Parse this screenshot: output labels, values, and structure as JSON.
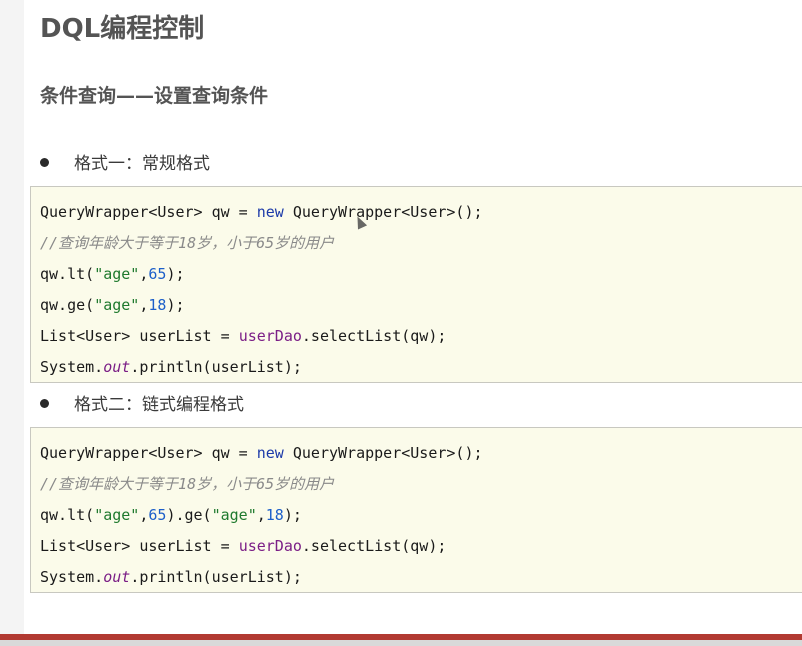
{
  "title": "DQL编程控制",
  "section": "条件查询——设置查询条件",
  "format1": {
    "bullet": "格式一：常规格式",
    "lines": [
      [
        {
          "t": "QueryWrapper<User> qw = "
        },
        {
          "t": "new",
          "c": "kw"
        },
        {
          "t": " QueryWrapper<User>();"
        }
      ],
      [
        {
          "t": "//查询年龄大于等于18岁，小于65岁的用户",
          "c": "cmt"
        }
      ],
      [
        {
          "t": "qw.lt("
        },
        {
          "t": "\"age\"",
          "c": "str"
        },
        {
          "t": ","
        },
        {
          "t": "65",
          "c": "num"
        },
        {
          "t": ");"
        }
      ],
      [
        {
          "t": "qw.ge("
        },
        {
          "t": "\"age\"",
          "c": "str"
        },
        {
          "t": ","
        },
        {
          "t": "18",
          "c": "num"
        },
        {
          "t": ");"
        }
      ],
      [
        {
          "t": "List<User> userList = "
        },
        {
          "t": "userDao",
          "c": "fld"
        },
        {
          "t": ".selectList(qw);"
        }
      ],
      [
        {
          "t": "System."
        },
        {
          "t": "out",
          "c": "stat"
        },
        {
          "t": ".println(userList);"
        }
      ]
    ]
  },
  "format2": {
    "bullet": "格式二：链式编程格式",
    "lines": [
      [
        {
          "t": "QueryWrapper<User> qw = "
        },
        {
          "t": "new",
          "c": "kw"
        },
        {
          "t": " QueryWrapper<User>();"
        }
      ],
      [
        {
          "t": "//查询年龄大于等于18岁，小于65岁的用户",
          "c": "cmt"
        }
      ],
      [
        {
          "t": "qw.lt("
        },
        {
          "t": "\"age\"",
          "c": "str"
        },
        {
          "t": ","
        },
        {
          "t": "65",
          "c": "num"
        },
        {
          "t": ").ge("
        },
        {
          "t": "\"age\"",
          "c": "str"
        },
        {
          "t": ","
        },
        {
          "t": "18",
          "c": "num"
        },
        {
          "t": ");"
        }
      ],
      [
        {
          "t": "List<User> userList = "
        },
        {
          "t": "userDao",
          "c": "fld"
        },
        {
          "t": ".selectList(qw);"
        }
      ],
      [
        {
          "t": "System."
        },
        {
          "t": "out",
          "c": "stat"
        },
        {
          "t": ".println(userList);"
        }
      ]
    ]
  },
  "colors": {
    "keyword": "#1c3aa8",
    "string": "#1f7a2e",
    "number": "#1c5fc9",
    "field": "#7b1e86",
    "comment": "#8a8a8a",
    "code_bg": "#fbfbea",
    "accent_bar": "#b23a32"
  }
}
